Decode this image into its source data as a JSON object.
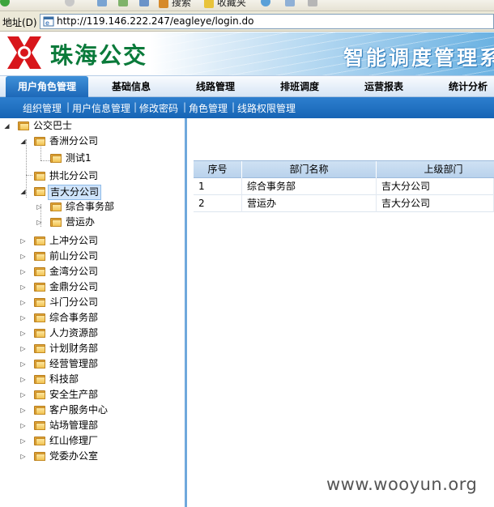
{
  "browser": {
    "toolbar": {
      "search_label": "搜索",
      "favorites_label": "收藏夹"
    },
    "address_label": "地址(D)",
    "url": "http://119.146.222.247/eagleye/login.do"
  },
  "brand": {
    "logo_text": "珠海公交",
    "system_title": "智能调度管理系",
    "logo_color": "#d8161b",
    "text_color": "#0a7a3a"
  },
  "main_nav": {
    "items": [
      {
        "label": "用户角色管理",
        "active": true
      },
      {
        "label": "基础信息"
      },
      {
        "label": "线路管理"
      },
      {
        "label": "排班调度"
      },
      {
        "label": "运营报表"
      },
      {
        "label": "统计分析"
      }
    ]
  },
  "sub_nav": {
    "items": [
      {
        "label": "组织管理"
      },
      {
        "label": "用户信息管理"
      },
      {
        "label": "修改密码"
      },
      {
        "label": "角色管理"
      },
      {
        "label": "线路权限管理"
      }
    ],
    "separator": "|"
  },
  "tree": {
    "root": "公交巴士",
    "nodes": [
      {
        "label": "香洲分公司",
        "expanded": true
      },
      {
        "label": "测试1"
      },
      {
        "label": "拱北分公司"
      },
      {
        "label": "吉大分公司",
        "expanded": true,
        "selected": true
      },
      {
        "label": "综合事务部"
      },
      {
        "label": "营运办"
      },
      {
        "label": "上冲分公司"
      },
      {
        "label": "前山分公司"
      },
      {
        "label": "金湾分公司"
      },
      {
        "label": "金鼎分公司"
      },
      {
        "label": "斗门分公司"
      },
      {
        "label": "综合事务部"
      },
      {
        "label": "人力资源部"
      },
      {
        "label": "计划财务部"
      },
      {
        "label": "经营管理部"
      },
      {
        "label": "科技部"
      },
      {
        "label": "安全生产部"
      },
      {
        "label": "客户服务中心"
      },
      {
        "label": "站场管理部"
      },
      {
        "label": "红山修理厂"
      },
      {
        "label": "党委办公室"
      }
    ]
  },
  "grid": {
    "columns": [
      "序号",
      "部门名称",
      "上级部门"
    ],
    "rows": [
      [
        "1",
        "综合事务部",
        "吉大分公司"
      ],
      [
        "2",
        "营运办",
        "吉大分公司"
      ]
    ]
  },
  "watermark": "www.wooyun.org"
}
